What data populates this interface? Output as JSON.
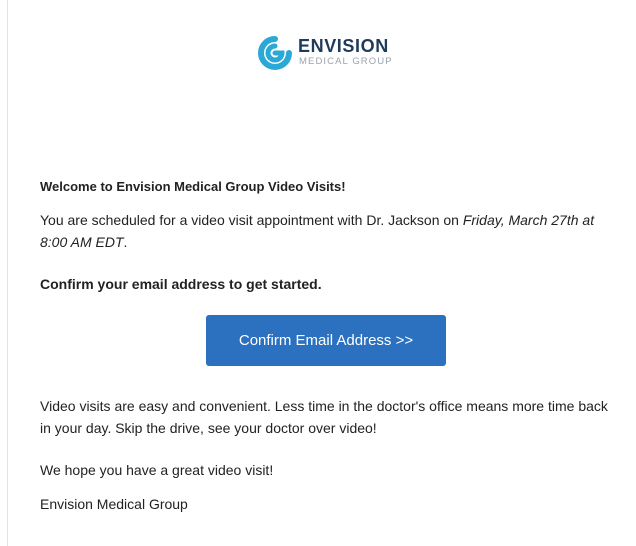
{
  "brand": {
    "name": "ENVISION",
    "tagline": "MEDICAL GROUP",
    "primary_color": "#2b71bf",
    "accent_color": "#2aa9d6",
    "text_color": "#1e3a5c"
  },
  "email": {
    "welcome": "Welcome to Envision Medical Group Video Visits!",
    "schedule_prefix": "You are scheduled for a video visit appointment with Dr. Jackson on ",
    "schedule_datetime": "Friday, March 27th at 8:00 AM EDT",
    "schedule_suffix": ".",
    "confirm_heading": "Confirm your email address to get started.",
    "confirm_button": "Confirm Email Address >>",
    "easy_text": "Video visits are easy and convenient. Less time in the doctor's office means more time back in your day. Skip the drive, see your doctor over video!",
    "hope_text": "We hope you have a great video visit!",
    "signature": "Envision Medical Group"
  }
}
